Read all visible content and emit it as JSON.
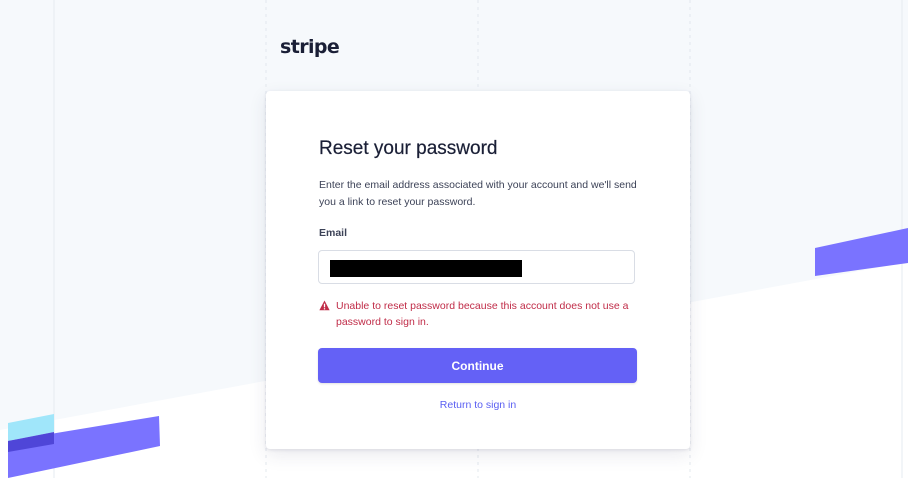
{
  "brand": {
    "logo_text": "stripe",
    "accent_color": "#6461f6",
    "link_color": "#5a5ff2",
    "error_color": "#c02c48"
  },
  "card": {
    "title": "Reset your password",
    "description": "Enter the email address associated with your account and we'll send you a link to reset your password.",
    "email_label": "Email",
    "email_value": "",
    "error_icon": "warning-triangle-icon",
    "error_message": "Unable to reset password because this account does not use a password to sign in.",
    "continue_label": "Continue",
    "return_link": "Return to sign in"
  }
}
